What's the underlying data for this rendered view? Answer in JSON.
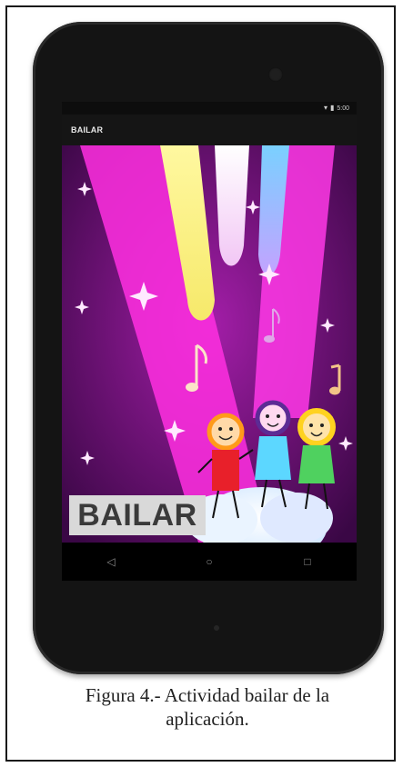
{
  "app": {
    "title": "BAILAR",
    "status_time": "5:00"
  },
  "content": {
    "label": "BAILAR"
  },
  "navbar": {
    "back_icon": "◁",
    "home_icon": "○",
    "recents_icon": "□"
  },
  "caption": {
    "line1": "Figura 4.- Actividad bailar de la",
    "line2": "aplicación."
  },
  "colors": {
    "background_purple": "#4d0b5a",
    "spotlight_magenta": "#ff22e0",
    "spotlight_yellow": "#fff27a",
    "spotlight_blue": "#8ad4ff",
    "label_bg": "#d9d9d9"
  }
}
